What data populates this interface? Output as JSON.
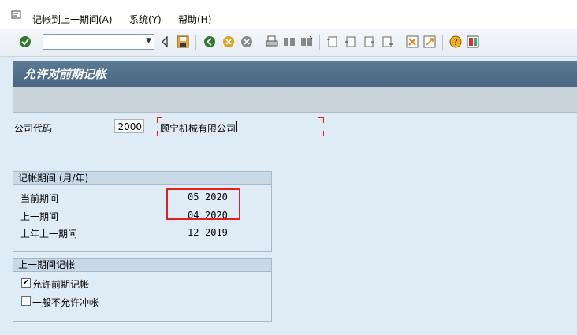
{
  "menu": {
    "items": [
      "记帐到上一期间(A)",
      "系统(Y)",
      "帮助(H)"
    ]
  },
  "toolbar": {
    "command_value": "",
    "icons": [
      "enter-icon",
      "save-icon",
      "back-icon",
      "exit-icon",
      "cancel-icon",
      "print-icon",
      "find-icon",
      "find-next-icon",
      "first-page-icon",
      "prev-page-icon",
      "next-page-icon",
      "last-page-icon",
      "new-session-icon",
      "shortcut-icon",
      "help-icon",
      "customize-icon"
    ]
  },
  "title": "允许对前期记帐",
  "company": {
    "label": "公司代码",
    "code": "2000",
    "name": "顾宁机械有限公司"
  },
  "period_group": {
    "heading": "记帐期间 (月/年)",
    "rows": [
      {
        "label": "当前期间",
        "month": "05",
        "year": "2020"
      },
      {
        "label": "上一期间",
        "month": "04",
        "year": "2020"
      },
      {
        "label": "上年上一期间",
        "month": "12",
        "year": "2019"
      }
    ]
  },
  "posting_group": {
    "heading": "上一期间记帐",
    "options": [
      {
        "label": "允许前期记帐",
        "checked": true
      },
      {
        "label": "一般不允许冲帐",
        "checked": false
      }
    ]
  },
  "colors": {
    "highlight_box": "#e02020",
    "title_bar": "#4f6d89"
  }
}
